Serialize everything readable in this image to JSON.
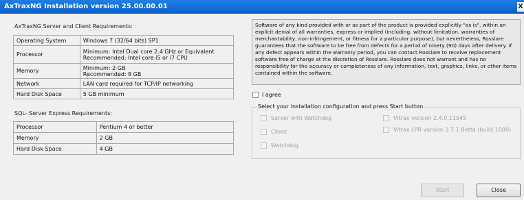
{
  "window": {
    "title": "AxTraxNG Installation version 25.00.00.01",
    "close_glyph": "X"
  },
  "server_requirements": {
    "title": "AxTraxNG Server and Client Requirements:",
    "rows": [
      [
        "Operating System",
        "Windows 7 (32/64 bits) SP1"
      ],
      [
        "Processor",
        "Minimum: Intel Dual core 2.4 GHz or Equivalent\nRecommended: Intel core i5 or i7 CPU"
      ],
      [
        "Memory",
        "Minimum: 2 GB\nRecommended: 8 GB"
      ],
      [
        "Network",
        "LAN card required for TCP/IP networking"
      ],
      [
        "Hard Disk Space",
        "5 GB minimum"
      ]
    ]
  },
  "sql_requirements": {
    "title": "SQL- Server Express Requirements:",
    "rows": [
      [
        "Processor",
        "Pentium 4 or better"
      ],
      [
        "Memory",
        "2 GB"
      ],
      [
        "Hard Disk Space",
        "4 GB"
      ]
    ]
  },
  "license_text": "Software of any kind provided with or as part of the product is provided explicitly \"as is\", within an explicit denial of all warranties, express or implied (including, without limitation, warranties of merchantability, non-infringement, or fitness for a particular purpose), but nevertheless, Rosslare guarantees that the software to be free from defects for a period of ninety (90) days after delivery. If any defect appears within the warranty period, you can contact Rosslare to receive replacement software free of charge at the discretion of Rosslare. Rosslare does not warrant and has no responsibility for the accuracy or completeness of any information, text, graphics, links, or other items contained within the software.",
  "agree": {
    "label": "I agree",
    "checked": false
  },
  "config": {
    "legend": "Select your installation configuration and press Start button",
    "options_left": [
      "Server with Watchdog",
      "Client",
      "Watchdog"
    ],
    "options_right": [
      "Vitrax version 2.4.0.11545",
      "Vitrax LPR version 1.7.1 Betta (build 1000)"
    ]
  },
  "buttons": {
    "start": "Start",
    "close": "Close"
  }
}
